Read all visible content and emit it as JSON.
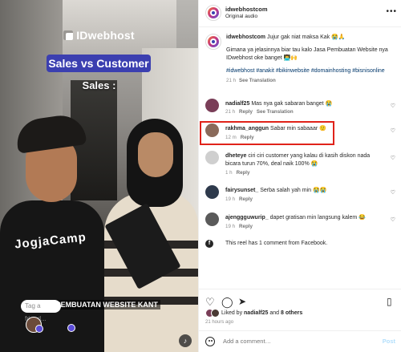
{
  "video": {
    "brand": "IDwebhost",
    "title": "Sales vs Customer",
    "speaker_label": "Sales :",
    "shirt_text": "JogjaCamp",
    "subtitle": "A PEMBUATAN WEBSITE KANT",
    "tag_placeholder": "Tag a friend..."
  },
  "header": {
    "username": "idwebhostcom",
    "audio": "Original audio",
    "more": "•••"
  },
  "caption": {
    "username": "idwebhostcom",
    "text": "Jujur gak niat maksa Kak 😭🙏",
    "body": "Gimana ya jelasinnya biar tau kalo Jasa Pembuatan Website nya IDwebhost oke banget 👨‍💻🙌",
    "hashtags": "#idwebhost #anakit #bikinwebsite #domainhosting #bisnisonline",
    "time": "21 h",
    "see_translation": "See Translation"
  },
  "comments": [
    {
      "user": "nadialf25",
      "text": "Mas nya gak sabaran banget 😭",
      "time": "21 h",
      "reply": "Reply",
      "translate": "See Translation",
      "avatar_color": "#7a3e58"
    },
    {
      "user": "rakhma_anggun",
      "text": "Sabar min sabaaar 🙂",
      "time": "12 m",
      "reply": "Reply",
      "translate": "",
      "avatar_color": "#8a6a5a"
    },
    {
      "user": "dheteye",
      "text": "ciri ciri customer yang kalau di kasih diskon nada bicara turun 70%, deal naik 100% 😭",
      "time": "1 h",
      "reply": "Reply",
      "translate": "",
      "avatar_color": "#cfcfcf"
    },
    {
      "user": "fairysunset_",
      "text": "Serba salah yah min 😭😭",
      "time": "19 h",
      "reply": "Reply",
      "translate": "",
      "avatar_color": "#2e3a4c"
    },
    {
      "user": "ajenggguwurip_",
      "text": "dapet gratisan min langsung kalem 😂",
      "time": "19 h",
      "reply": "Reply",
      "translate": "",
      "avatar_color": "#5a5a5a"
    }
  ],
  "facebook_note": "This reel has 1 comment from Facebook.",
  "likes": {
    "prefix": "Liked by",
    "user": "nadialf25",
    "conjunction": "and",
    "others": "8 others",
    "time_ago": "21 hours ago"
  },
  "add_comment": {
    "placeholder": "Add a comment…",
    "post": "Post"
  },
  "colors": {
    "accent_blue": "#3b3fb0",
    "highlight_red": "#e0231a",
    "post_disabled": "#b2dffc"
  }
}
